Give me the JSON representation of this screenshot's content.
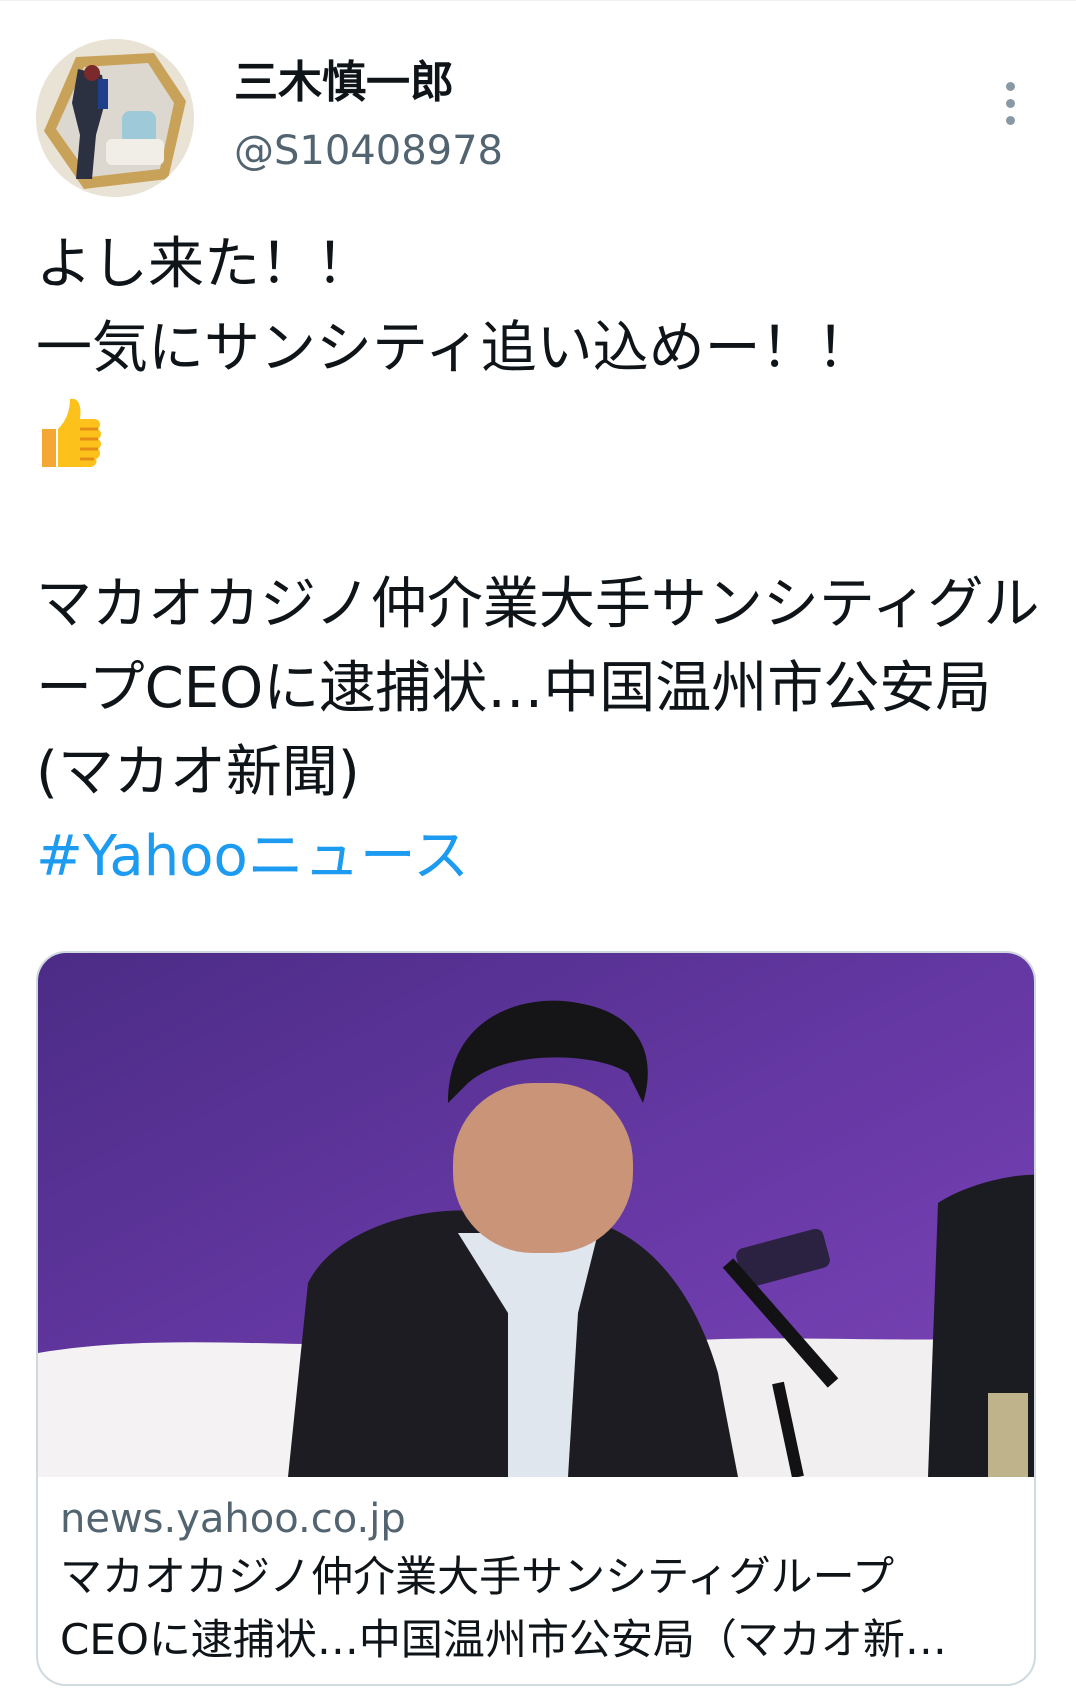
{
  "author": {
    "display_name": "三木慎一郎",
    "handle": "@S10408978"
  },
  "tweet": {
    "lines": [
      "よし来た！！",
      "一気にサンシティ追い込めー！！"
    ],
    "emoji": "👍",
    "headline": "マカオカジノ仲介業大手サンシティグループCEOに逮捕状…中国温州市公安局(マカオ新聞)",
    "hashtag": "#Yahooニュース"
  },
  "card": {
    "domain": "news.yahoo.co.jp",
    "title_line1": "マカオカジノ仲介業大手サンシティグループ",
    "title_line2": "CEOに逮捕状…中国温州市公安局（マカオ新…"
  },
  "icons": {
    "more": "more-vertical-icon",
    "thumbs_up": "thumbs-up-emoji"
  },
  "colors": {
    "link": "#1d9bf0",
    "secondary_text": "#536471",
    "border": "#cfd9de"
  }
}
